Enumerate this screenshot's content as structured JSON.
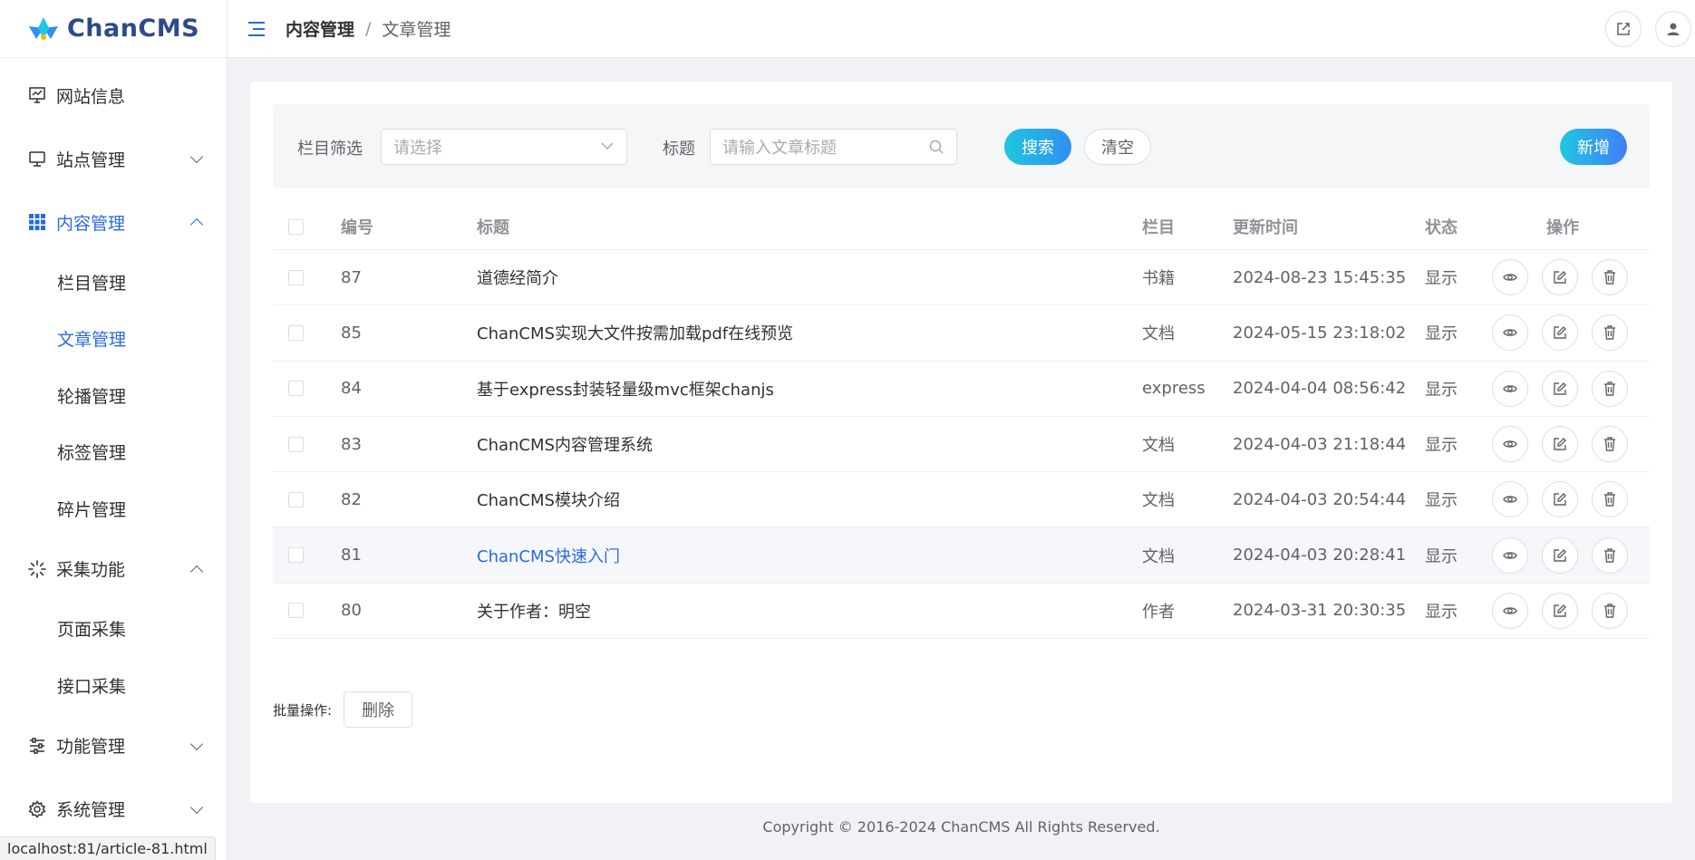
{
  "app": {
    "name": "ChanCMS"
  },
  "sidebar": {
    "items": [
      {
        "label": "网站信息",
        "icon": "monitor-chart-icon",
        "expanded": null
      },
      {
        "label": "站点管理",
        "icon": "desktop-icon",
        "expanded": false
      },
      {
        "label": "内容管理",
        "icon": "grid-icon",
        "expanded": true,
        "active": true,
        "children": [
          "栏目管理",
          "文章管理",
          "轮播管理",
          "标签管理",
          "碎片管理"
        ],
        "active_child": "文章管理"
      },
      {
        "label": "采集功能",
        "icon": "loading-icon",
        "expanded": true,
        "children": [
          "页面采集",
          "接口采集"
        ]
      },
      {
        "label": "功能管理",
        "icon": "sliders-icon",
        "expanded": false
      },
      {
        "label": "系统管理",
        "icon": "gear-icon",
        "expanded": false
      }
    ]
  },
  "header": {
    "breadcrumb": [
      "内容管理",
      "文章管理"
    ],
    "separator": "/"
  },
  "filter": {
    "category_label": "栏目筛选",
    "category_placeholder": "请选择",
    "title_label": "标题",
    "title_placeholder": "请输入文章标题",
    "search_label": "搜索",
    "clear_label": "清空",
    "add_label": "新增"
  },
  "table": {
    "columns": [
      "编号",
      "标题",
      "栏目",
      "更新时间",
      "状态",
      "操作"
    ],
    "rows": [
      {
        "id": "87",
        "title": "道德经简介",
        "category": "书籍",
        "updated": "2024-08-23 15:45:35",
        "status": "显示"
      },
      {
        "id": "85",
        "title": "ChanCMS实现大文件按需加载pdf在线预览",
        "category": "文档",
        "updated": "2024-05-15 23:18:02",
        "status": "显示"
      },
      {
        "id": "84",
        "title": "基于express封装轻量级mvc框架chanjs",
        "category": "express",
        "updated": "2024-04-04 08:56:42",
        "status": "显示"
      },
      {
        "id": "83",
        "title": "ChanCMS内容管理系统",
        "category": "文档",
        "updated": "2024-04-03 21:18:44",
        "status": "显示"
      },
      {
        "id": "82",
        "title": "ChanCMS模块介绍",
        "category": "文档",
        "updated": "2024-04-03 20:54:44",
        "status": "显示"
      },
      {
        "id": "81",
        "title": "ChanCMS快速入门",
        "category": "文档",
        "updated": "2024-04-03 20:28:41",
        "status": "显示",
        "hovered": true
      },
      {
        "id": "80",
        "title": "关于作者：明空",
        "category": "作者",
        "updated": "2024-03-31 20:30:35",
        "status": "显示"
      }
    ]
  },
  "batch": {
    "label": "批量操作:",
    "delete_label": "删除"
  },
  "footer": {
    "copyright": "Copyright © 2016-2024 ChanCMS All Rights Reserved."
  },
  "statusbar": {
    "url": "localhost:81/article-81.html"
  },
  "colors": {
    "accent": "#2a6ae0",
    "gradient_start": "#1fc7e0",
    "gradient_end": "#2f8ff2",
    "brand_text": "#2d4a8a"
  }
}
